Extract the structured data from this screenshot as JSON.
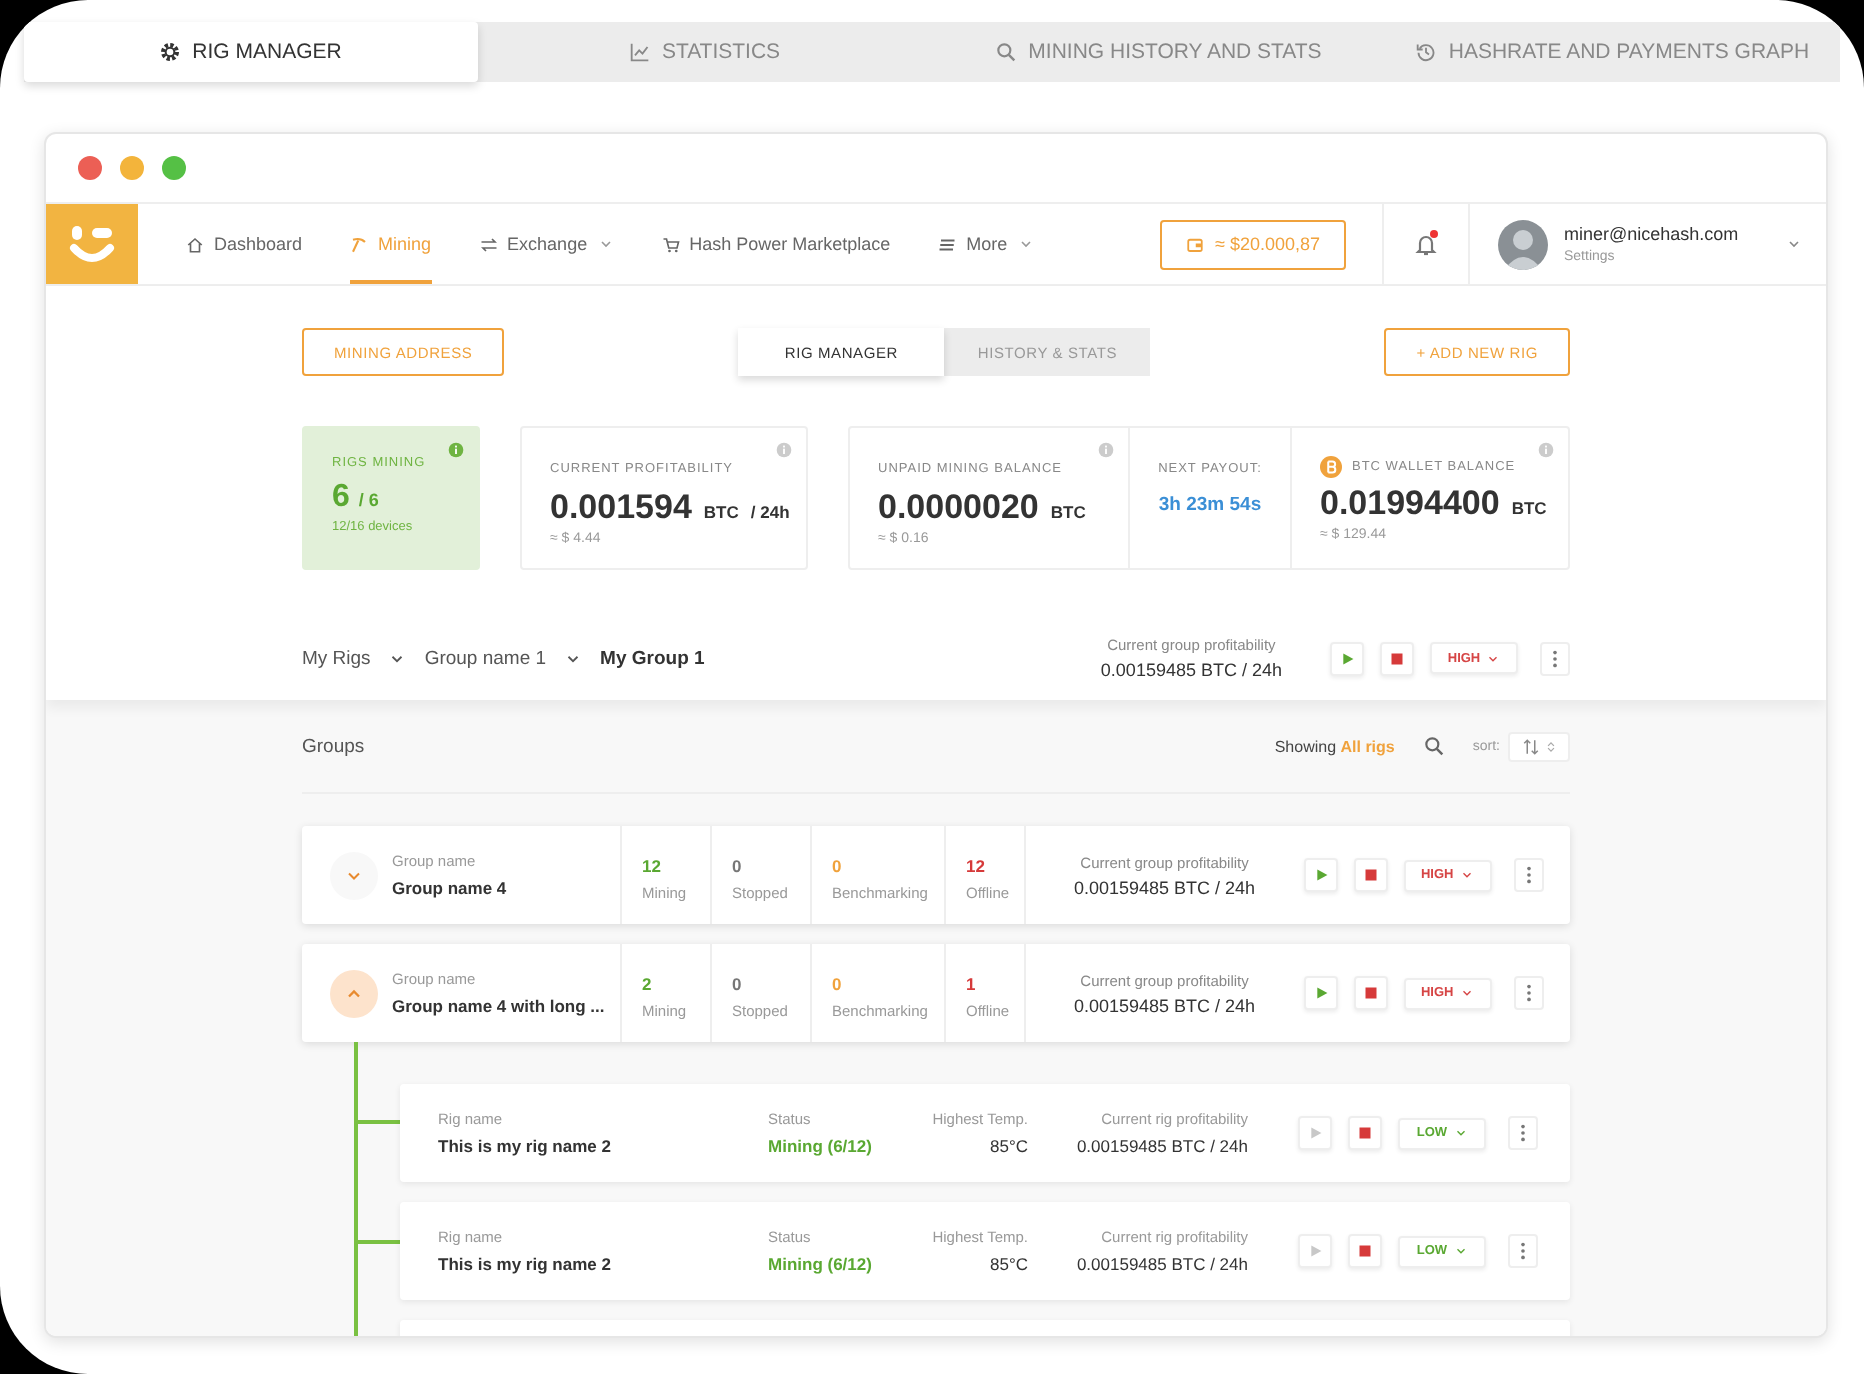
{
  "top_tabs": [
    {
      "label": "RIG MANAGER",
      "selected": true
    },
    {
      "label": "STATISTICS",
      "selected": false
    },
    {
      "label": "MINING HISTORY AND STATS",
      "selected": false
    },
    {
      "label": "HASHRATE AND PAYMENTS GRAPH",
      "selected": false
    }
  ],
  "nav": {
    "items": [
      {
        "label": "Dashboard",
        "selected": false,
        "dropdown": false
      },
      {
        "label": "Mining",
        "selected": true,
        "dropdown": false
      },
      {
        "label": "Exchange",
        "selected": false,
        "dropdown": true
      },
      {
        "label": "Hash Power Marketplace",
        "selected": false,
        "dropdown": false
      },
      {
        "label": "More",
        "selected": false,
        "dropdown": true
      }
    ],
    "balance": "≈ $20.000,87",
    "notification": true,
    "user": {
      "email": "miner@nicehash.com",
      "subtitle": "Settings"
    }
  },
  "actions": {
    "mining_address": "MINING ADDRESS",
    "view_tabs": [
      {
        "label": "RIG MANAGER",
        "selected": true
      },
      {
        "label": "HISTORY & STATS",
        "selected": false
      }
    ],
    "add_rig": "+ ADD NEW RIG"
  },
  "stats": {
    "rigs": {
      "label": "RIGS MINING",
      "value": "6",
      "total": "/ 6",
      "devices": "12/16 devices"
    },
    "profitability": {
      "label": "CURRENT PROFITABILITY",
      "value": "0.001594",
      "unit": "BTC",
      "period": "/ 24h",
      "usd": "≈ $ 4.44"
    },
    "unpaid": {
      "label": "UNPAID MINING BALANCE",
      "value": "0.0000020",
      "unit": "BTC",
      "usd": "≈ $ 0.16"
    },
    "payout": {
      "label": "NEXT PAYOUT:",
      "value": "3h 23m 54s"
    },
    "wallet": {
      "label": "BTC WALLET BALANCE",
      "value": "0.01994400",
      "unit": "BTC",
      "usd": "≈ $ 129.44"
    }
  },
  "breadcrumb": [
    "My Rigs",
    "Group name 1",
    "My Group 1"
  ],
  "group_profit": {
    "label": "Current group profitability",
    "value": "0.00159485 BTC / 24h",
    "power": {
      "label": "HIGH",
      "color": "#d64545"
    }
  },
  "groups_header": {
    "title": "Groups",
    "showing": "Showing",
    "filter": "All rigs",
    "sort_label": "sort:"
  },
  "groups": [
    {
      "label": "Group name",
      "name": "Group name 4",
      "expanded": false,
      "counts": [
        {
          "kind": "mining",
          "value": "12",
          "label": "Mining"
        },
        {
          "kind": "stopped",
          "value": "0",
          "label": "Stopped"
        },
        {
          "kind": "benchmarking",
          "value": "0",
          "label": "Benchmarking"
        },
        {
          "kind": "offline",
          "value": "12",
          "label": "Offline"
        }
      ],
      "profit_label": "Current group profitability",
      "profit": "0.00159485 BTC / 24h",
      "power": {
        "label": "HIGH",
        "color": "#d64545"
      }
    },
    {
      "label": "Group name",
      "name": "Group name 4 with long ...",
      "expanded": true,
      "counts": [
        {
          "kind": "mining",
          "value": "2",
          "label": "Mining"
        },
        {
          "kind": "stopped",
          "value": "0",
          "label": "Stopped"
        },
        {
          "kind": "benchmarking",
          "value": "0",
          "label": "Benchmarking"
        },
        {
          "kind": "offline",
          "value": "1",
          "label": "Offline"
        }
      ],
      "profit_label": "Current group profitability",
      "profit": "0.00159485 BTC / 24h",
      "power": {
        "label": "HIGH",
        "color": "#d64545"
      }
    }
  ],
  "rigs": [
    {
      "label": "Rig name",
      "name": "This is my rig name 2",
      "status_label": "Status",
      "status": "Mining (6/12)",
      "temp_label": "Highest Temp.",
      "temp": "85°C",
      "profit_label": "Current rig profitability",
      "profit": "0.00159485 BTC / 24h",
      "running": true,
      "power": {
        "label": "LOW",
        "color": "#5aa832"
      }
    },
    {
      "label": "Rig name",
      "name": "This is my rig name 2",
      "status_label": "Status",
      "status": "Mining (6/12)",
      "temp_label": "Highest Temp.",
      "temp": "85°C",
      "profit_label": "Current rig profitability",
      "profit": "0.00159485 BTC / 24h",
      "running": true,
      "power": {
        "label": "LOW",
        "color": "#5aa832"
      }
    }
  ]
}
